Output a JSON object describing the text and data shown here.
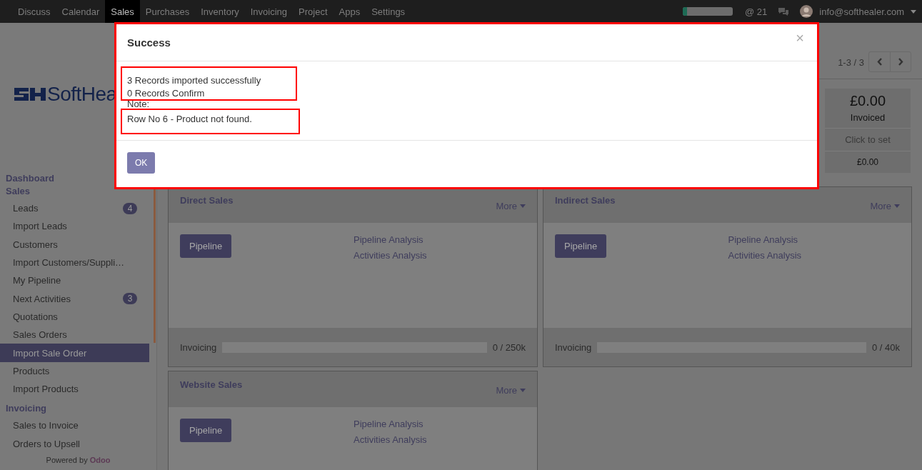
{
  "navbar": {
    "apps": [
      {
        "label": "Discuss",
        "selected": false
      },
      {
        "label": "Calendar",
        "selected": false
      },
      {
        "label": "Sales",
        "selected": true
      },
      {
        "label": "Purchases",
        "selected": false
      },
      {
        "label": "Inventory",
        "selected": false
      },
      {
        "label": "Invoicing",
        "selected": false
      },
      {
        "label": "Project",
        "selected": false
      },
      {
        "label": "Apps",
        "selected": false
      },
      {
        "label": "Settings",
        "selected": false
      }
    ],
    "progress": {
      "level": 0.08
    },
    "mentions_symbol": "@",
    "mentions": "21",
    "user": "info@softhealer.com"
  },
  "sidebar": {
    "logo": "SoftHea",
    "sections": [
      {
        "title": "Dashboard"
      },
      {
        "title": "Sales",
        "items": [
          {
            "label": "Leads",
            "badge": "4",
            "selected": false
          },
          {
            "label": "Import Leads",
            "selected": false
          },
          {
            "label": "Customers",
            "selected": false
          },
          {
            "label": "Import Customers/Suppli…",
            "selected": false
          },
          {
            "label": "My Pipeline",
            "selected": false
          },
          {
            "label": "Next Activities",
            "badge": "3",
            "selected": false
          },
          {
            "label": "Quotations",
            "selected": false
          },
          {
            "label": "Sales Orders",
            "selected": false
          },
          {
            "label": "Import Sale Order",
            "selected": true
          },
          {
            "label": "Products",
            "selected": false
          },
          {
            "label": "Import Products",
            "selected": false
          }
        ]
      },
      {
        "title": "Invoicing",
        "items": [
          {
            "label": "Sales to Invoice",
            "selected": false
          },
          {
            "label": "Orders to Upsell",
            "selected": false
          }
        ]
      }
    ],
    "footer": "Powered by",
    "footer_brand": "Odoo"
  },
  "pager": "1-3 / 3",
  "stat_box": {
    "amount": "£0.00",
    "label": "Invoiced",
    "target": "Click to set",
    "total": "£0.00"
  },
  "teams": [
    {
      "name": "Direct Sales",
      "more": "More",
      "button": "Pipeline",
      "links": [
        "Pipeline Analysis",
        "Activities Analysis"
      ],
      "progress_label": "Invoicing",
      "level": 0,
      "reading": "0 / 250k"
    },
    {
      "name": "Indirect Sales",
      "more": "More",
      "button": "Pipeline",
      "links": [
        "Pipeline Analysis",
        "Activities Analysis"
      ],
      "progress_label": "Invoicing",
      "level": 0,
      "reading": "0 / 40k"
    },
    {
      "name": "Website Sales",
      "more": "More",
      "button": "Pipeline",
      "links": [
        "Pipeline Analysis",
        "Activities Analysis"
      ]
    }
  ],
  "dialog": {
    "title": "Success",
    "close": "×",
    "lines": [
      "3 Records imported successfully",
      "0 Records Confirm"
    ],
    "note_label": "Note:",
    "notes": [
      "Row No 6  - Product not found."
    ],
    "button": "OK"
  }
}
